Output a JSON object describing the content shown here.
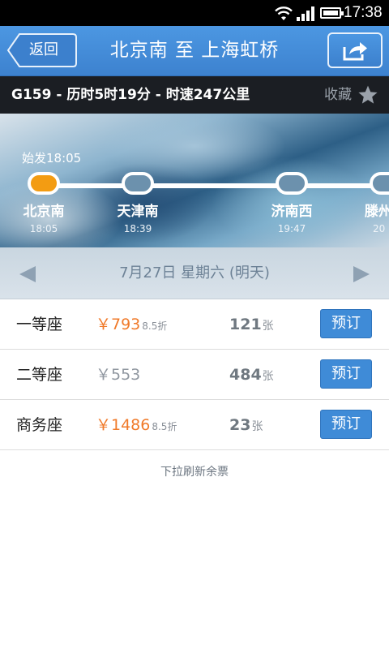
{
  "status_bar": {
    "time": "17:38",
    "wifi_icon": "wifi-icon",
    "signal_icon": "cell-signal-icon",
    "battery_icon": "battery-icon"
  },
  "header": {
    "back_label": "返回",
    "title": "北京南 至 上海虹桥",
    "share_icon": "share-icon"
  },
  "train_info": {
    "summary": "G159 - 历时5时19分 - 时速247公里",
    "favorite_label": "收藏",
    "favorite_icon": "star-icon"
  },
  "route": {
    "depart_label": "始发18:05",
    "stops": [
      {
        "name": "北京南",
        "time": "18:05",
        "current": true
      },
      {
        "name": "天津南",
        "time": "18:39",
        "current": false
      },
      {
        "name": "济南西",
        "time": "19:47",
        "current": false
      },
      {
        "name": "滕州",
        "time": "20",
        "current": false
      }
    ]
  },
  "date_bar": {
    "date": "7月27日 星期六 (明天)",
    "prev_icon": "arrow-left-icon",
    "next_icon": "arrow-right-icon"
  },
  "seats": [
    {
      "name": "一等座",
      "price": "￥793",
      "discount": "8.5折",
      "count": "121",
      "unit": "张",
      "book_label": "预订",
      "price_color": "#f07a2a"
    },
    {
      "name": "二等座",
      "price": "￥553",
      "discount": "",
      "count": "484",
      "unit": "张",
      "book_label": "预订",
      "price_color": "#9097a0"
    },
    {
      "name": "商务座",
      "price": "￥1486",
      "discount": "8.5折",
      "count": "23",
      "unit": "张",
      "book_label": "预订",
      "price_color": "#f07a2a"
    }
  ],
  "refresh_hint": "下拉刷新余票",
  "colors": {
    "header_blue": "#3d82cf",
    "accent_orange": "#f39c12",
    "button_blue": "#3f8bd7"
  }
}
